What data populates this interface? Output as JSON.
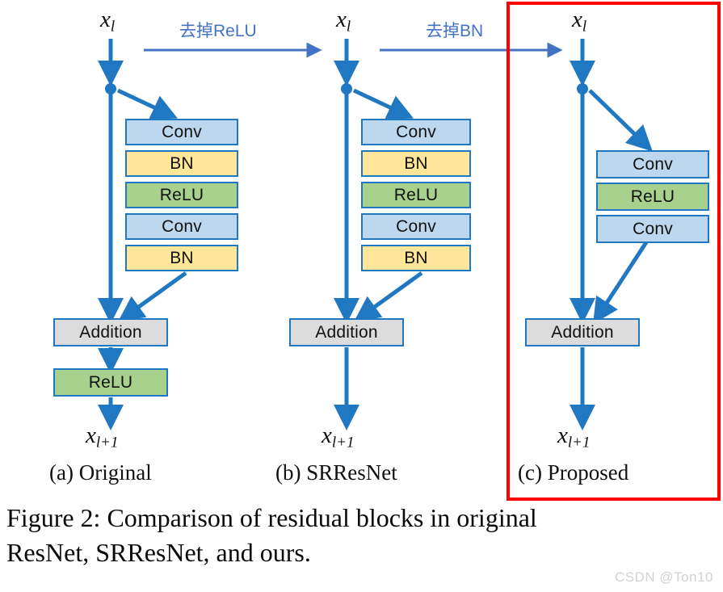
{
  "figure": {
    "caption": "Figure 2: Comparison of residual blocks in original ResNet, SRResNet, and ours.",
    "watermark": "CSDN @Ton10",
    "input_label": "x",
    "input_sub": "l",
    "output_label": "x",
    "output_sub": "l+1"
  },
  "annotations": [
    {
      "id": "remove-relu",
      "text": "去掉ReLU"
    },
    {
      "id": "remove-bn",
      "text": "去掉BN"
    }
  ],
  "colors": {
    "conv": "#bdd7ee",
    "bn": "#ffe699",
    "relu": "#a9d18e",
    "addition": "#dcdcdc",
    "border": "#1f78c1",
    "arrow": "#1f78c1",
    "annotation_text": "#4472c4",
    "highlight_box": "#ff0000"
  },
  "columns": [
    {
      "id": "a",
      "label": "(a) Original",
      "blocks": [
        {
          "text": "Conv",
          "type": "conv"
        },
        {
          "text": "BN",
          "type": "bn"
        },
        {
          "text": "ReLU",
          "type": "relu"
        },
        {
          "text": "Conv",
          "type": "conv"
        },
        {
          "text": "BN",
          "type": "bn"
        }
      ],
      "merge": {
        "text": "Addition",
        "type": "add"
      },
      "post": [
        {
          "text": "ReLU",
          "type": "relu"
        }
      ]
    },
    {
      "id": "b",
      "label": "(b) SRResNet",
      "blocks": [
        {
          "text": "Conv",
          "type": "conv"
        },
        {
          "text": "BN",
          "type": "bn"
        },
        {
          "text": "ReLU",
          "type": "relu"
        },
        {
          "text": "Conv",
          "type": "conv"
        },
        {
          "text": "BN",
          "type": "bn"
        }
      ],
      "merge": {
        "text": "Addition",
        "type": "add"
      },
      "post": []
    },
    {
      "id": "c",
      "label": "(c) Proposed",
      "highlighted": true,
      "blocks": [
        {
          "text": "Conv",
          "type": "conv"
        },
        {
          "text": "ReLU",
          "type": "relu"
        },
        {
          "text": "Conv",
          "type": "conv"
        }
      ],
      "merge": {
        "text": "Addition",
        "type": "add"
      },
      "post": []
    }
  ]
}
